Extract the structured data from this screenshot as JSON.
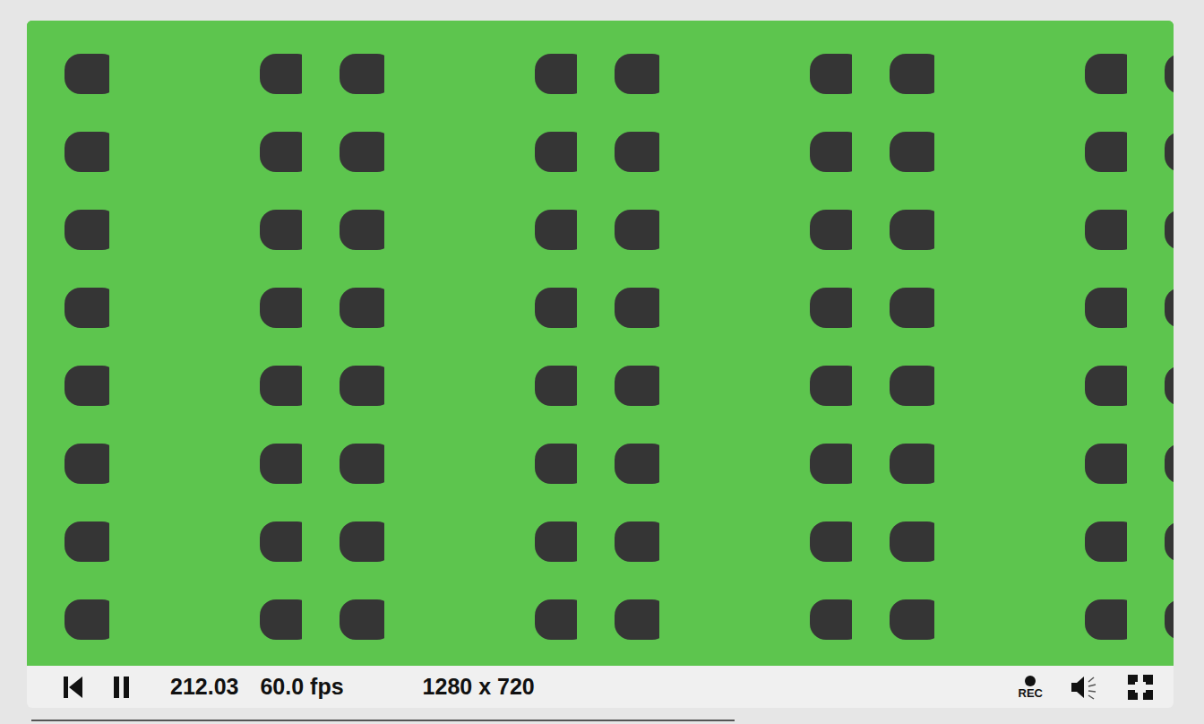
{
  "player": {
    "time": "212.03",
    "fps": "60.0 fps",
    "resolution": "1280 x 720",
    "playing": true,
    "record_label": "REC"
  }
}
